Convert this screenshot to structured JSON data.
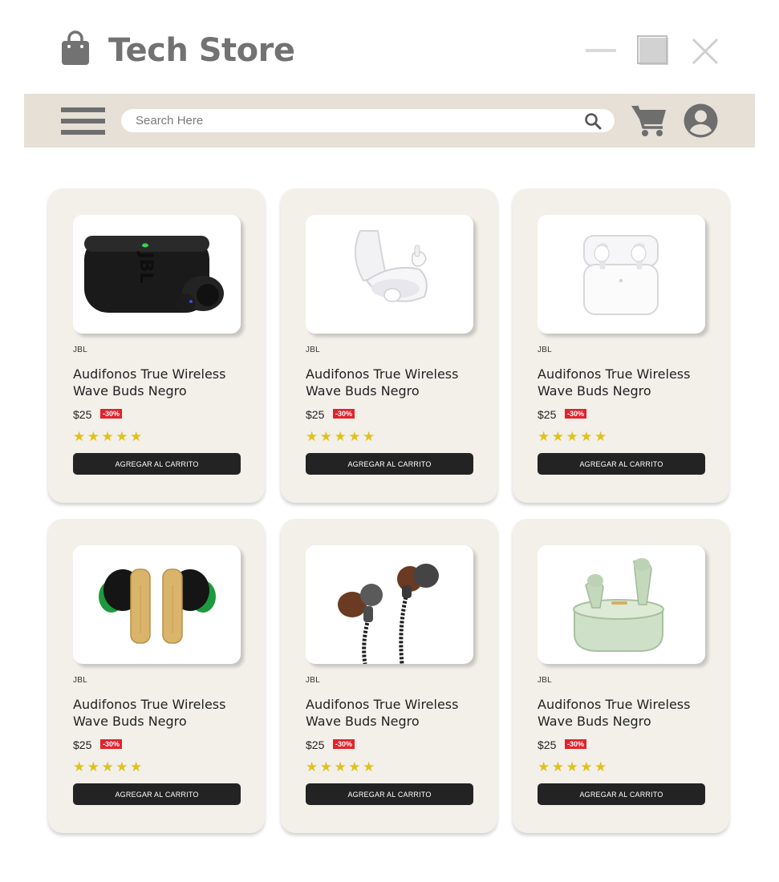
{
  "app": {
    "title": "Tech Store",
    "icon": "shopping-bag-icon"
  },
  "window_controls": [
    "minimize-icon",
    "maximize-icon",
    "close-icon"
  ],
  "toolbar": {
    "menu_icon": "hamburger-menu-icon",
    "search_placeholder": "Search Here",
    "search_icon": "search-icon",
    "cart_icon": "cart-icon",
    "user_icon": "user-avatar-icon",
    "background": "#e6e0d7"
  },
  "colors": {
    "card_bg": "#f3f0ea",
    "button_bg": "#232323",
    "discount_bg": "#e2222c",
    "star": "#e0c11c"
  },
  "products": [
    {
      "brand": "JBL",
      "name": "Audifonos True Wireless Wave Buds Negro",
      "price": "$25",
      "discount": "-30%",
      "stars": "★★★★★",
      "rating": 5,
      "button": "AGREGAR AL CARRITO",
      "image": "black-earbuds-case"
    },
    {
      "brand": "JBL",
      "name": "Audifonos True Wireless Wave Buds Negro",
      "price": "$25",
      "discount": "-30%",
      "stars": "★★★★★",
      "rating": 5,
      "button": "AGREGAR AL CARRITO",
      "image": "white-earbuds-open-case"
    },
    {
      "brand": "JBL",
      "name": "Audifonos True Wireless Wave Buds Negro",
      "price": "$25",
      "discount": "-30%",
      "stars": "★★★★★",
      "rating": 5,
      "button": "AGREGAR AL CARRITO",
      "image": "white-airpods-case"
    },
    {
      "brand": "JBL",
      "name": "Audifonos True Wireless Wave Buds Negro",
      "price": "$25",
      "discount": "-30%",
      "stars": "★★★★★",
      "rating": 5,
      "button": "AGREGAR AL CARRITO",
      "image": "bamboo-green-earbuds"
    },
    {
      "brand": "JBL",
      "name": "Audifonos True Wireless Wave Buds Negro",
      "price": "$25",
      "discount": "-30%",
      "stars": "★★★★★",
      "rating": 5,
      "button": "AGREGAR AL CARRITO",
      "image": "wooden-wired-earphones"
    },
    {
      "brand": "JBL",
      "name": "Audifonos True Wireless Wave Buds Negro",
      "price": "$25",
      "discount": "-30%",
      "stars": "★★★★★",
      "rating": 5,
      "button": "AGREGAR AL CARRITO",
      "image": "mint-earbuds-case"
    }
  ]
}
